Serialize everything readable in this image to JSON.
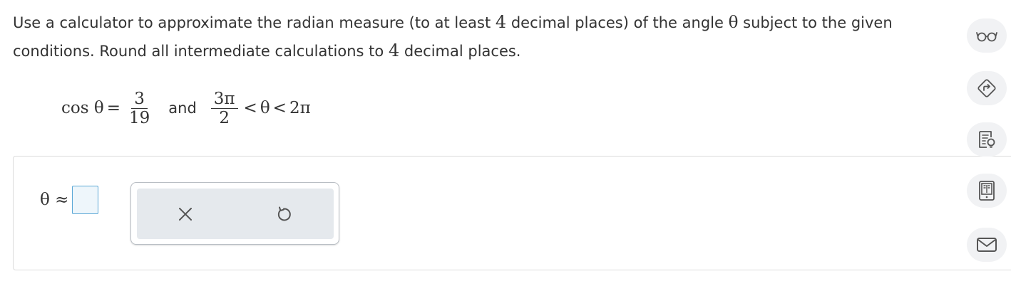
{
  "question": {
    "part1": "Use a calculator to approximate the radian measure (to at least ",
    "num1": "4",
    "part2": " decimal places) of the angle ",
    "theta": "θ",
    "part3": " subject to the given conditions. Round all intermediate calculations to ",
    "num2": "4",
    "part4": " decimal places."
  },
  "condition": {
    "cos_label": "cos θ",
    "equals": "=",
    "frac1_num": "3",
    "frac1_den": "19",
    "and_word": "and",
    "frac2_num": "3π",
    "frac2_den": "2",
    "lt1": "<",
    "theta": "θ",
    "lt2": "<",
    "upper": "2π"
  },
  "answer": {
    "label": "θ ≈",
    "value": ""
  },
  "tools": {
    "clear_icon": "x-icon",
    "undo_icon": "undo-icon"
  },
  "sidebar": {
    "items": [
      {
        "name": "glasses-icon"
      },
      {
        "name": "direction-sign-icon"
      },
      {
        "name": "notes-icon"
      },
      {
        "name": "ebook-icon"
      },
      {
        "name": "mail-icon"
      }
    ]
  },
  "colors": {
    "input_border": "#5aa7d6",
    "input_bg": "#eef6fb",
    "tool_bg": "#e5e9ed",
    "icon": "#555555"
  }
}
